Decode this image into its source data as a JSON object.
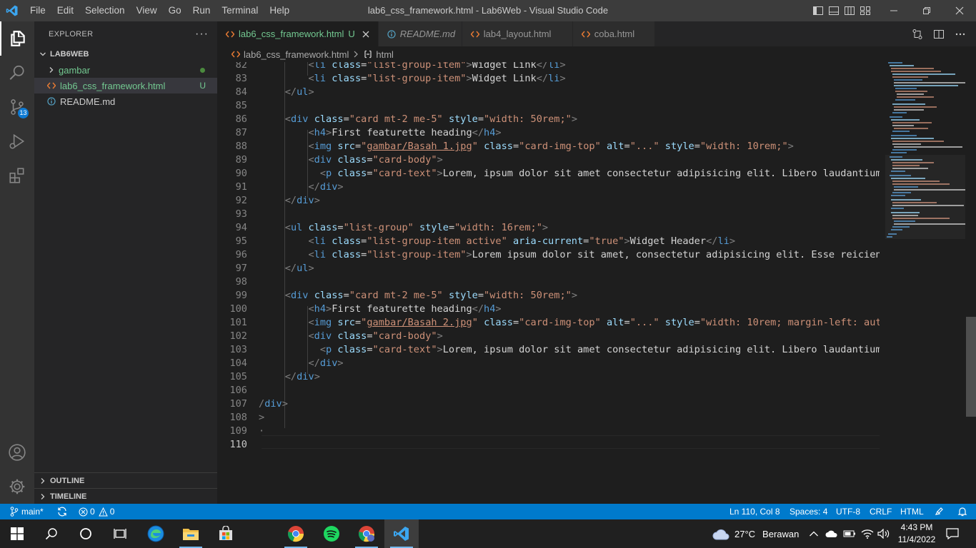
{
  "window": {
    "title": "lab6_css_framework.html - Lab6Web - Visual Studio Code",
    "menu": [
      "File",
      "Edit",
      "Selection",
      "View",
      "Go",
      "Run",
      "Terminal",
      "Help"
    ]
  },
  "activity": {
    "scm_badge": "13"
  },
  "explorer": {
    "header": "EXPLORER",
    "more": "···",
    "workspace": "LAB6WEB",
    "items": [
      {
        "label": "gambar",
        "status": ""
      },
      {
        "label": "lab6_css_framework.html",
        "status": "U"
      },
      {
        "label": "README.md",
        "status": ""
      }
    ],
    "outline": "OUTLINE",
    "timeline": "TIMELINE"
  },
  "tabs": [
    {
      "label": "lab6_css_framework.html",
      "status": "U"
    },
    {
      "label": "README.md",
      "status": ""
    },
    {
      "label": "lab4_layout.html",
      "status": ""
    },
    {
      "label": "coba.html",
      "status": ""
    }
  ],
  "breadcrumb": {
    "file": "lab6_css_framework.html",
    "symbol": "html"
  },
  "editor": {
    "line_numbers": [
      "82",
      "83",
      "84",
      "85",
      "86",
      "87",
      "88",
      "89",
      "90",
      "91",
      "92",
      "93",
      "94",
      "95",
      "96",
      "97",
      "98",
      "99",
      "100",
      "101",
      "102",
      "103",
      "104",
      "105",
      "106",
      "107",
      "108",
      "109",
      "110"
    ]
  },
  "status": {
    "branch": "main*",
    "errors": "0",
    "warnings": "0",
    "position": "Ln 110, Col 8",
    "spaces": "Spaces: 4",
    "encoding": "UTF-8",
    "eol": "CRLF",
    "language": "HTML"
  },
  "taskbar": {
    "weather_temp": "27°C",
    "weather_desc": "Berawan",
    "time": "4:43 PM",
    "date": "11/4/2022"
  },
  "colors": {
    "accent": "#007acc",
    "untracked": "#73c991",
    "html_icon": "#e37933"
  }
}
